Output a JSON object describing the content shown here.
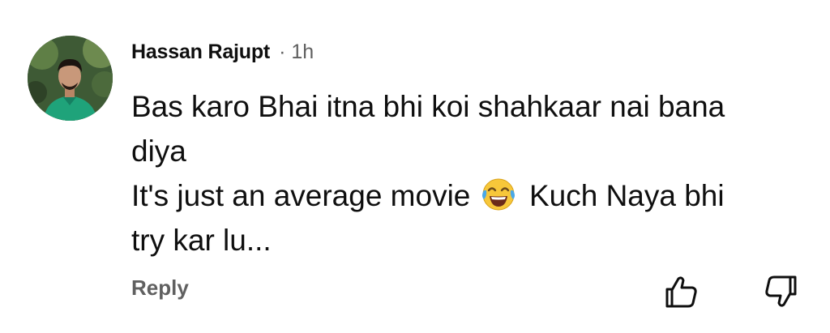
{
  "comment": {
    "author": "Hassan Rajupt",
    "separator": "·",
    "timestamp": "1h",
    "text_lines": [
      "Bas karo Bhai itna bhi koi shahkaar nai bana",
      "diya",
      "It's just an average movie",
      "Kuch Naya bhi",
      "try kar lu..."
    ],
    "emoji": "face-with-tears-of-joy",
    "reply_label": "Reply"
  },
  "icons": {
    "like": "thumbs-up-icon",
    "dislike": "thumbs-down-icon"
  },
  "colors": {
    "primary_text": "#0f0f0f",
    "secondary_text": "#606060",
    "background": "#ffffff"
  }
}
